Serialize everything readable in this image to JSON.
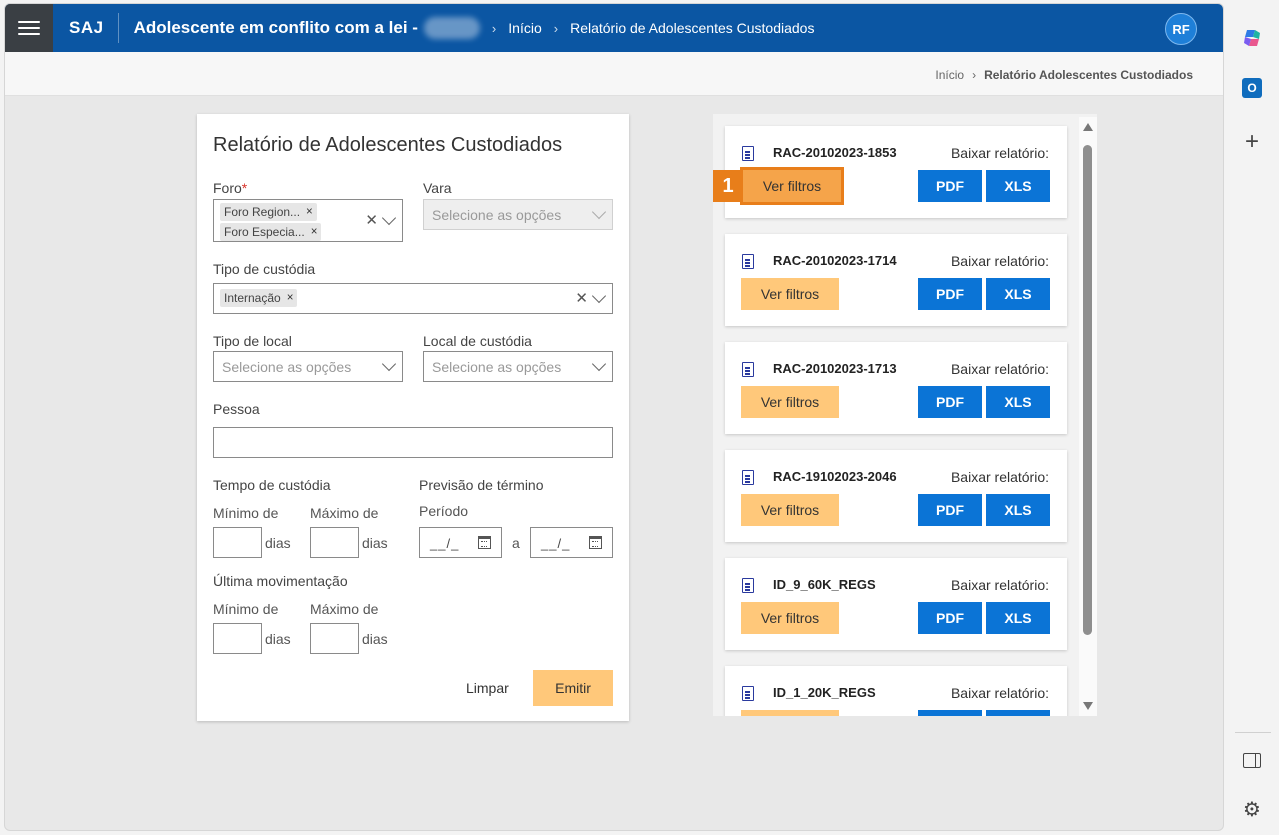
{
  "header": {
    "brand": "SAJ",
    "module": "Adolescente em conflito com a lei -",
    "crumbs": [
      "Início",
      "Relatório de Adolescentes Custodiados"
    ],
    "avatar": "RF"
  },
  "subcrumb": {
    "home": "Início",
    "current": "Relatório Adolescentes Custodiados"
  },
  "form": {
    "title": "Relatório de Adolescentes Custodiados",
    "foro_label": "Foro",
    "foro_required": "*",
    "foro_tags": [
      "Foro Region...",
      "Foro Especia..."
    ],
    "vara_label": "Vara",
    "vara_placeholder": "Selecione as opções",
    "tipo_custodia_label": "Tipo de custódia",
    "tipo_custodia_tag": "Internação",
    "tipo_local_label": "Tipo de local",
    "tipo_local_placeholder": "Selecione as opções",
    "local_custodia_label": "Local de custódia",
    "local_custodia_placeholder": "Selecione as opções",
    "pessoa_label": "Pessoa",
    "pessoa_value": "",
    "tempo_label": "Tempo de custódia",
    "minimo": "Mínimo de",
    "maximo": "Máximo de",
    "dias": "dias",
    "previsao_label": "Previsão de término",
    "periodo": "Período",
    "date_mask": "__/_",
    "a": "a",
    "ultima_label": "Última movimentação",
    "limpar": "Limpar",
    "emitir": "Emitir"
  },
  "reports": {
    "download_label": "Baixar relatório:",
    "filters_label": "Ver filtros",
    "pdf": "PDF",
    "xls": "XLS",
    "badge": "1",
    "items": [
      "RAC-20102023-1853",
      "RAC-20102023-1714",
      "RAC-20102023-1713",
      "RAC-19102023-2046",
      "ID_9_60K_REGS",
      "ID_1_20K_REGS"
    ]
  },
  "colors": {
    "topbar": "#0b56a3",
    "primary_button": "#0b74d6",
    "secondary_button": "#ffc87a",
    "highlight": "#e87e1a"
  },
  "rail_icons": [
    "copilot-icon",
    "outlook-icon",
    "plus-icon",
    "panel-icon",
    "gear-icon"
  ]
}
